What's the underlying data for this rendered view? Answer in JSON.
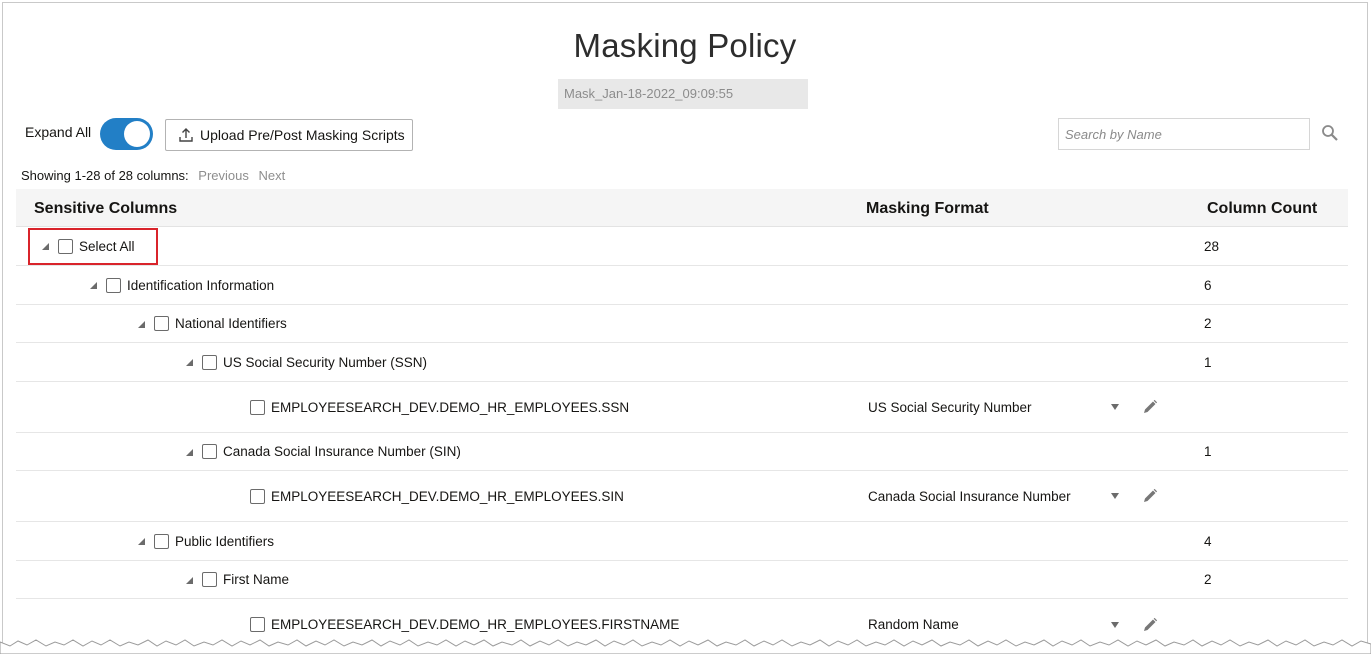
{
  "page": {
    "title": "Masking Policy",
    "policy_name": "Mask_Jan-18-2022_09:09:55"
  },
  "toolbar": {
    "expand_all_label": "Expand All",
    "expand_all_on": true,
    "upload_label": "Upload Pre/Post Masking Scripts",
    "search_placeholder": "Search by Name"
  },
  "pagination": {
    "showing": "Showing 1-28 of 28 columns:",
    "previous": "Previous",
    "next": "Next"
  },
  "table": {
    "headers": {
      "sensitive_columns": "Sensitive Columns",
      "masking_format": "Masking Format",
      "column_count": "Column Count"
    },
    "rows": [
      {
        "label": "Select All",
        "count": "28",
        "level": 0
      },
      {
        "label": "Identification Information",
        "count": "6",
        "level": 1
      },
      {
        "label": "National Identifiers",
        "count": "2",
        "level": 2
      },
      {
        "label": "US Social Security Number (SSN)",
        "count": "1",
        "level": 3
      },
      {
        "label": "EMPLOYEESEARCH_DEV.DEMO_HR_EMPLOYEES.SSN",
        "format": "US Social Security Number",
        "level": 4
      },
      {
        "label": "Canada Social Insurance Number (SIN)",
        "count": "1",
        "level": 3
      },
      {
        "label": "EMPLOYEESEARCH_DEV.DEMO_HR_EMPLOYEES.SIN",
        "format": "Canada Social Insurance Number",
        "level": 4
      },
      {
        "label": "Public Identifiers",
        "count": "4",
        "level": 2
      },
      {
        "label": "First Name",
        "count": "2",
        "level": 3
      },
      {
        "label": "EMPLOYEESEARCH_DEV.DEMO_HR_EMPLOYEES.FIRSTNAME",
        "format": "Random Name",
        "level": 4
      }
    ]
  },
  "colors": {
    "accent": "#227fc6",
    "highlight": "#d9242b"
  }
}
